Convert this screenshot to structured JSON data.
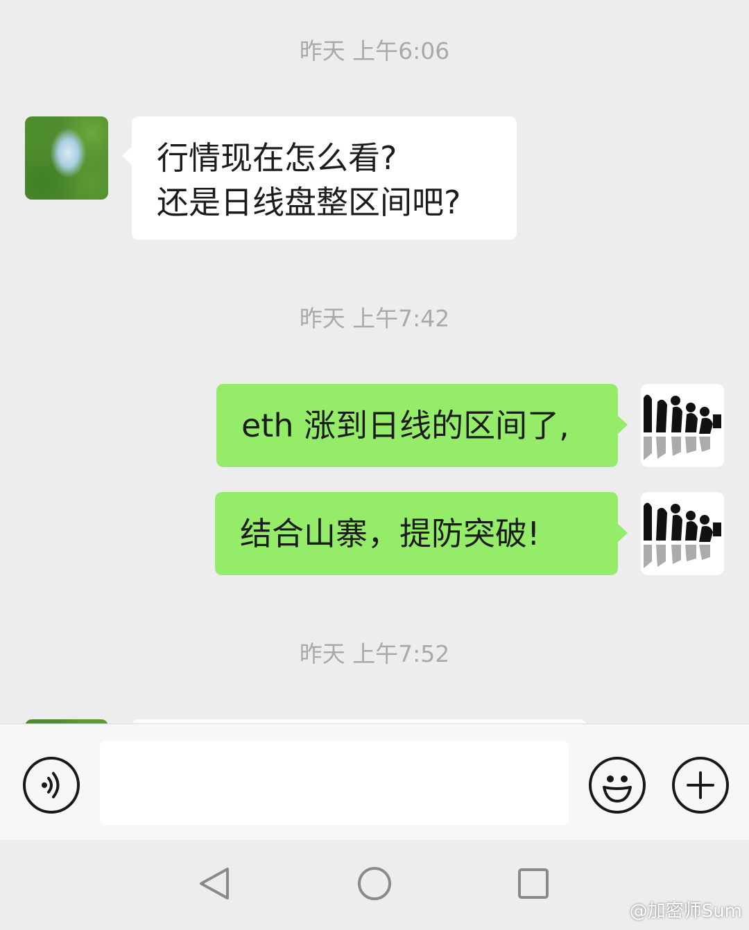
{
  "messages": {
    "ts1": "昨天 上午6:06",
    "msg1": "行情现在怎么看?\n还是日线盘整区间吧?",
    "ts2": "昨天 上午7:42",
    "msg2": "eth 涨到日线的区间了,",
    "msg3": "结合山寨，提防突破!",
    "ts3": "昨天 上午7:52"
  },
  "input": {
    "placeholder": ""
  },
  "icons": {
    "voice": "voice-icon",
    "emoji": "emoji-icon",
    "plus": "plus-icon",
    "back": "back-triangle-icon",
    "home": "home-circle-icon",
    "recents": "recents-square-icon"
  },
  "colors": {
    "background": "#ededed",
    "incoming_bubble": "#ffffff",
    "outgoing_bubble": "#95ec69",
    "timestamp": "#a9a9a9"
  },
  "watermark": "@加密师Sum"
}
